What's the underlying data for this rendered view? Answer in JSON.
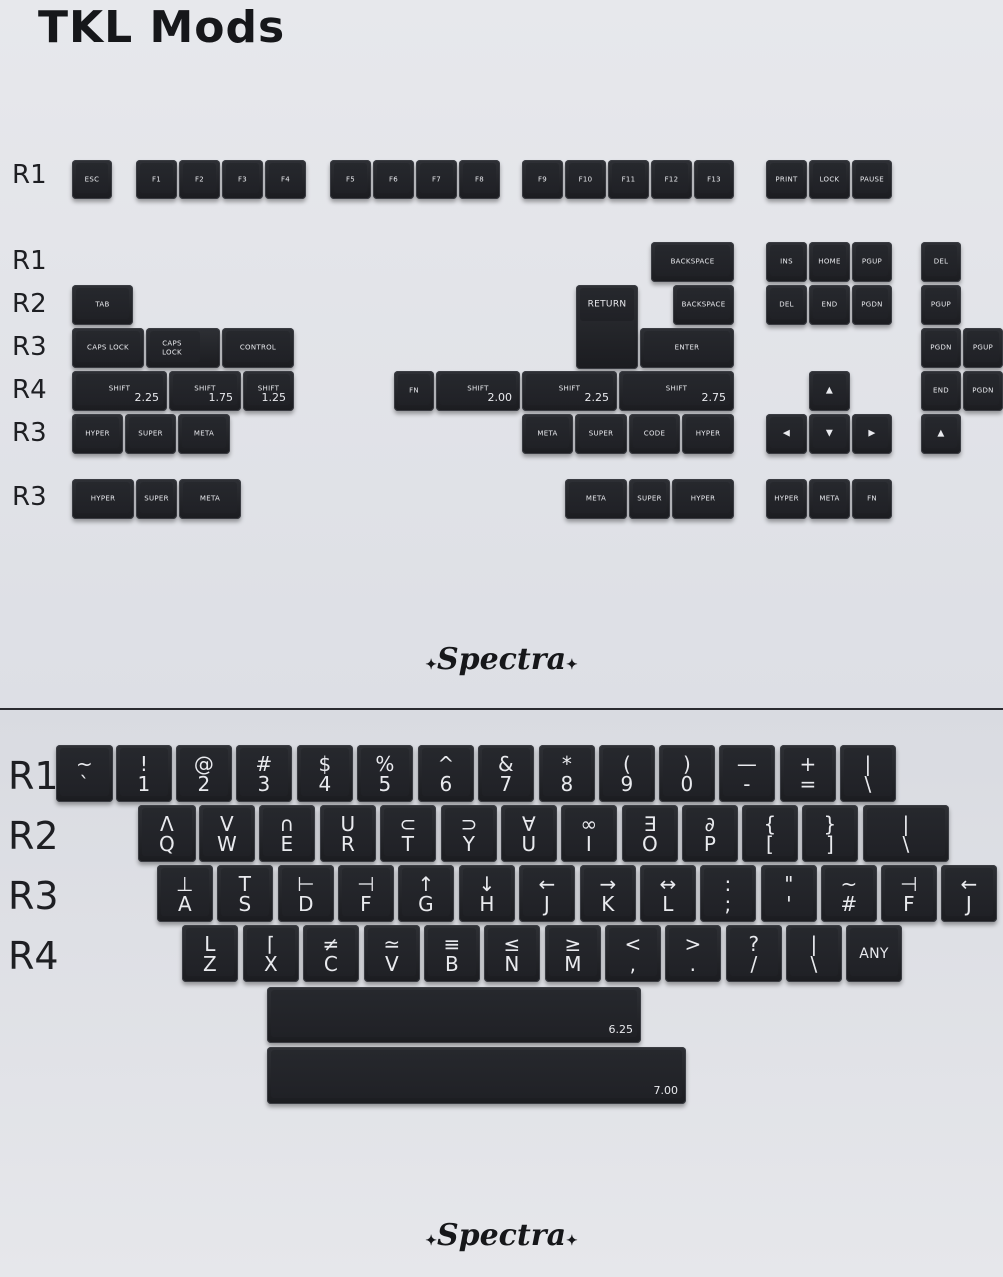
{
  "title": "TKL Mods",
  "brand": "Spectra",
  "top": {
    "row_labels": [
      "R1",
      "R1",
      "R2",
      "R3",
      "R4",
      "R3",
      "R3"
    ],
    "keys": {
      "esc": "ESC",
      "f1": "F1",
      "f2": "F2",
      "f3": "F3",
      "f4": "F4",
      "f5": "F5",
      "f6": "F6",
      "f7": "F7",
      "f8": "F8",
      "f9": "F9",
      "f10": "F10",
      "f11": "F11",
      "f12": "F12",
      "f13": "F13",
      "print": "PRINT",
      "lock": "LOCK",
      "pause": "PAUSE",
      "backspace": "BACKSPACE",
      "backspace_small": "BACKSPACE",
      "ins": "INS",
      "home": "HOME",
      "pgup": "PGUP",
      "del_r1": "DEL",
      "tab": "TAB",
      "return": "RETURN",
      "del": "DEL",
      "end": "END",
      "pgdn": "PGDN",
      "pgup_r2": "PGUP",
      "caps_lock": "CAPS  LOCK",
      "caps_lock_stacked": "CAPS\nLOCK",
      "control": "CONTROL",
      "enter": "ENTER",
      "pgdn_r3": "PGDN",
      "pgup_r3": "PGUP",
      "shift": "SHIFT",
      "fn": "FN",
      "end_r4": "END",
      "pgdn_r4": "PGDN",
      "hyper": "HYPER",
      "super": "SUPER",
      "meta": "META",
      "code": "CODE",
      "fn_b": "FN",
      "arrow_up": "▲",
      "arrow_left": "◀",
      "arrow_down": "▼",
      "arrow_right": "▶"
    },
    "units": {
      "u225": "2.25",
      "u175": "1.75",
      "u125": "1.25",
      "u200": "2.00",
      "u275": "2.75"
    }
  },
  "bottom": {
    "row_labels": [
      "R1",
      "R2",
      "R3",
      "R4"
    ],
    "r1": [
      [
        "~",
        "`"
      ],
      [
        "!",
        "1"
      ],
      [
        "@",
        "2"
      ],
      [
        "#",
        "3"
      ],
      [
        "$",
        "4"
      ],
      [
        "%",
        "5"
      ],
      [
        "^",
        "6"
      ],
      [
        "&",
        "7"
      ],
      [
        "*",
        "8"
      ],
      [
        "(",
        "9"
      ],
      [
        ")",
        "0"
      ],
      [
        "—",
        "-"
      ],
      [
        "+",
        "="
      ],
      [
        "|",
        "\\"
      ]
    ],
    "r2": [
      [
        "Λ",
        "Q"
      ],
      [
        "V",
        "W"
      ],
      [
        "∩",
        "E"
      ],
      [
        "U",
        "R"
      ],
      [
        "⊂",
        "T"
      ],
      [
        "⊃",
        "Y"
      ],
      [
        "∀",
        "U"
      ],
      [
        "∞",
        "I"
      ],
      [
        "∃",
        "O"
      ],
      [
        "∂",
        "P"
      ],
      [
        "{",
        "["
      ],
      [
        "}",
        "]"
      ],
      [
        "|",
        "\\"
      ]
    ],
    "r3": [
      [
        "⊥",
        "A"
      ],
      [
        "T",
        "S"
      ],
      [
        "⊢",
        "D"
      ],
      [
        "⊣",
        "F"
      ],
      [
        "↑",
        "G"
      ],
      [
        "↓",
        "H"
      ],
      [
        "←",
        "J"
      ],
      [
        "→",
        "K"
      ],
      [
        "↔",
        "L"
      ],
      [
        ":",
        ";"
      ],
      [
        "\"",
        "'"
      ],
      [
        "~",
        "#"
      ],
      [
        "⊣",
        "F"
      ],
      [
        "←",
        "J"
      ]
    ],
    "r4": [
      [
        "L",
        "Z"
      ],
      [
        "⌈",
        "X"
      ],
      [
        "≠",
        "C"
      ],
      [
        "≃",
        "V"
      ],
      [
        "≡",
        "B"
      ],
      [
        "≤",
        "N"
      ],
      [
        "≥",
        "M"
      ],
      [
        "<",
        ","
      ],
      [
        ">",
        "."
      ],
      [
        "?",
        "/"
      ],
      [
        "|",
        "\\"
      ],
      [
        "ANY",
        ""
      ]
    ],
    "space_units": [
      "6.25",
      "7.00"
    ]
  }
}
